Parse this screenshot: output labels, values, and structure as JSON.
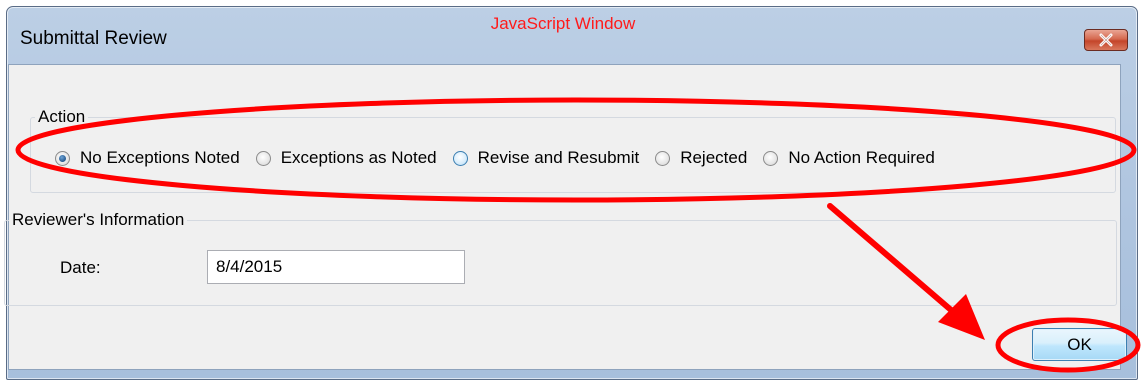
{
  "window": {
    "title": "Submittal Review"
  },
  "annotation": {
    "label": "JavaScript Window",
    "color": "#ff1a1a"
  },
  "action_group": {
    "legend": "Action",
    "options": [
      {
        "label": "No Exceptions Noted",
        "selected": true
      },
      {
        "label": "Exceptions as Noted",
        "selected": false
      },
      {
        "label": "Revise and Resubmit",
        "selected": false
      },
      {
        "label": "Rejected",
        "selected": false
      },
      {
        "label": "No Action Required",
        "selected": false
      }
    ]
  },
  "reviewer_group": {
    "legend": "Reviewer's Information",
    "date_label": "Date:",
    "date_value": "8/4/2015"
  },
  "buttons": {
    "ok_label": "OK"
  },
  "icons": {
    "close": "close-icon",
    "radio": "radio-icon"
  }
}
